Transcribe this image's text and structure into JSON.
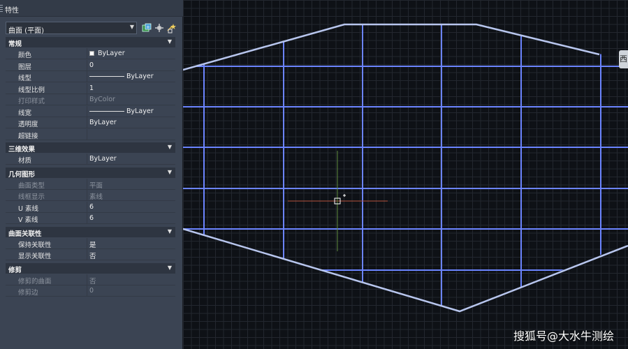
{
  "palette": {
    "title": "特性",
    "object_select": {
      "value": "曲面 (平面)"
    },
    "toolbar": {
      "toggle_pickadd_icon": "toggle-pickadd-icon",
      "select_objects_icon": "select-objects-icon",
      "quick_select_icon": "quick-select-icon"
    },
    "sections": [
      {
        "title": "常规",
        "rows": [
          {
            "name": "颜色",
            "value": "ByLayer",
            "swatch": "#ffffff"
          },
          {
            "name": "图层",
            "value": "0"
          },
          {
            "name": "线型",
            "value": "ByLayer",
            "line": true
          },
          {
            "name": "线型比例",
            "value": "1"
          },
          {
            "name": "打印样式",
            "value": "ByColor",
            "dim": true
          },
          {
            "name": "线宽",
            "value": "ByLayer",
            "line": true
          },
          {
            "name": "透明度",
            "value": "ByLayer"
          },
          {
            "name": "超链接",
            "value": ""
          }
        ]
      },
      {
        "title": "三维效果",
        "rows": [
          {
            "name": "材质",
            "value": "ByLayer"
          }
        ]
      },
      {
        "title": "几何图形",
        "rows": [
          {
            "name": "曲面类型",
            "value": "平面",
            "dim": true
          },
          {
            "name": "线框显示",
            "value": "素线",
            "dim": true
          },
          {
            "name": "U 素线",
            "value": "6"
          },
          {
            "name": "V 素线",
            "value": "6"
          }
        ]
      },
      {
        "title": "曲面关联性",
        "rows": [
          {
            "name": "保持关联性",
            "value": "是"
          },
          {
            "name": "显示关联性",
            "value": "否"
          }
        ]
      },
      {
        "title": "修剪",
        "rows": [
          {
            "name": "修剪的曲面",
            "value": "否",
            "dim": true
          },
          {
            "name": "修剪边",
            "value": "0",
            "dim": true
          }
        ]
      }
    ]
  },
  "viewport": {
    "viewcube_label": "西",
    "watermark": "搜狐号@大水牛测绘",
    "colors": {
      "background": "#0e1116",
      "surface_edges": "#b8c6ee",
      "isolines": "#6b84ff",
      "crosshair_x": "#b5533f",
      "crosshair_y": "#5f8a3c"
    }
  }
}
